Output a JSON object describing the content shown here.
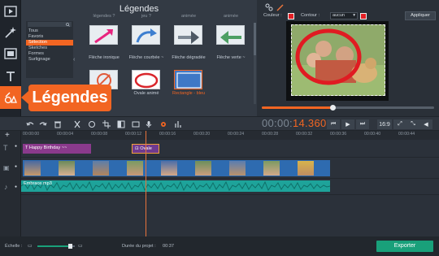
{
  "app": {
    "accent": "#f26522",
    "export_color": "#19a07a",
    "left_bar": [
      {
        "icon": "film-icon"
      },
      {
        "icon": "magic-wand-icon"
      },
      {
        "icon": "filmstrip-icon"
      },
      {
        "icon": "text-icon"
      },
      {
        "icon": "shapes-icon"
      },
      {
        "icon": "menu-lines-icon"
      }
    ],
    "callout_label": "Légendes"
  },
  "titles_panel": {
    "title": "Légendes",
    "categories": [
      "Tous",
      "Favoris",
      "Sélection",
      "Sketches",
      "Formes",
      "Surlignage"
    ],
    "selected_category": "Sélection",
    "cut_labels": [
      "légendes ?",
      "jeu ?",
      "animée",
      "animée"
    ],
    "items": [
      {
        "label": "Flèche ironique",
        "highlight": false
      },
      {
        "label": "Flèche courbée ~",
        "highlight": false
      },
      {
        "label": "Flèche dégradée",
        "highlight": false
      },
      {
        "label": "Flèche verte ~",
        "highlight": false
      },
      {
        "label": "",
        "highlight": false
      },
      {
        "label": "Ovale animé",
        "highlight": false
      },
      {
        "label": "Rectangle - bleu",
        "highlight": true
      }
    ]
  },
  "properties": {
    "color_label": "Couleur :",
    "outline_label": "Contour :",
    "outline_value": "aucun",
    "apply_label": "Appliquer",
    "color": "#e31e24"
  },
  "timecode": {
    "prefix": "00:00:",
    "value": "14.360"
  },
  "player": {
    "aspect": "16:9",
    "progress": 0.41
  },
  "ruler": [
    "00:00:00",
    "00:00:04",
    "00:00:08",
    "00:00:12",
    "00:00:16",
    "00:00:20",
    "00:00:24",
    "00:00:28",
    "00:00:32",
    "00:00:36",
    "00:00:40",
    "00:00:44"
  ],
  "tracks": {
    "title_clip": "Happy Birthday ~~",
    "caption_clip": "Ovale",
    "audio_clip": "Embrace.mp3"
  },
  "status": {
    "scale_label": "Échelle :",
    "duration_label": "Durée du projet :",
    "duration_value": "00:37",
    "export_label": "Exporter",
    "zoom": 0.87
  }
}
